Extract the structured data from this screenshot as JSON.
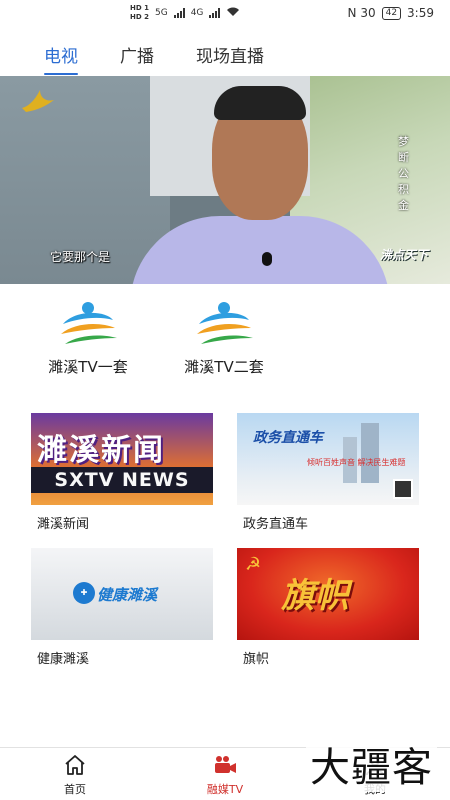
{
  "status_bar": {
    "hd1": "HD 1",
    "hd2": "HD 2",
    "net1": "5G",
    "net2": "4G",
    "icons_right": "N 30",
    "battery": "42",
    "time": "3:59"
  },
  "top_tabs": [
    {
      "label": "电视",
      "active": true
    },
    {
      "label": "广播",
      "active": false
    },
    {
      "label": "现场直播",
      "active": false
    }
  ],
  "video": {
    "subtitle": "它要那个是",
    "side_caption": "梦断公积金",
    "watermark": "沸点天下"
  },
  "channels": [
    {
      "label": "濉溪TV一套",
      "icon": "sxtv-logo-icon"
    },
    {
      "label": "濉溪TV二套",
      "icon": "sxtv-logo-icon"
    }
  ],
  "programs": [
    {
      "label": "濉溪新闻",
      "thumb_title": "濉溪新闻",
      "thumb_bar": "SXTV NEWS"
    },
    {
      "label": "政务直通车",
      "thumb_title": "政务直通车",
      "thumb_line": "倾听百姓声音 解决民生难题"
    },
    {
      "label": "健康濉溪",
      "thumb_title": "健康濉溪"
    },
    {
      "label": "旗帜",
      "thumb_title": "旗帜"
    }
  ],
  "bottom_nav": [
    {
      "label": "首页",
      "icon": "home-icon",
      "active": false
    },
    {
      "label": "融媒TV",
      "icon": "video-camera-icon",
      "active": true
    },
    {
      "label": "我的",
      "icon": "user-icon",
      "active": false
    }
  ],
  "brand_watermark": "大疆客",
  "colors": {
    "tab_active": "#2c6dd2",
    "nav_active": "#d0312d"
  }
}
